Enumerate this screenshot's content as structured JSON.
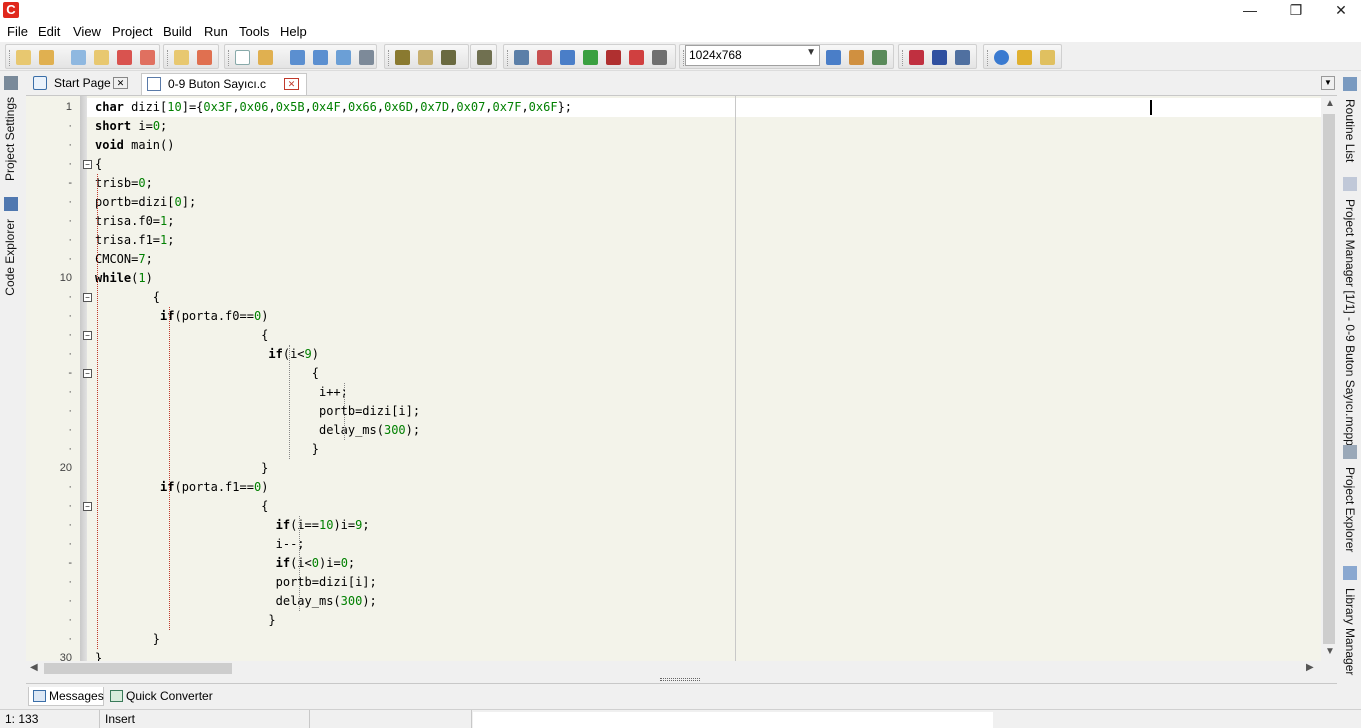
{
  "window": {
    "logo": "C",
    "min": "—",
    "max": "❐",
    "close": "✕"
  },
  "menu": [
    "File",
    "Edit",
    "View",
    "Project",
    "Build",
    "Run",
    "Tools",
    "Help"
  ],
  "toolbar": {
    "resolution": "1024x768"
  },
  "left_dock": {
    "project_settings": "Project Settings",
    "code_explorer": "Code Explorer"
  },
  "right_dock": {
    "routine_list": "Routine List",
    "project_manager": "Project Manager [1/1] - 0-9 Buton Sayıcı.mcppi",
    "project_explorer": "Project Explorer",
    "library_manager": "Library Manager"
  },
  "tabs": {
    "start_page": "Start Page",
    "file": "0-9 Buton Sayıcı.c"
  },
  "code": {
    "lines": [
      {
        "n": "1",
        "text": "char dizi[10]={0x3F,0x06,0x5B,0x4F,0x66,0x6D,0x7D,0x07,0x7F,0x6F};"
      },
      {
        "n": "·",
        "text": "short i=0;"
      },
      {
        "n": "·",
        "text": "void main()"
      },
      {
        "n": "·",
        "text": "{"
      },
      {
        "n": "-",
        "text": "trisb=0;"
      },
      {
        "n": "·",
        "text": "portb=dizi[0];"
      },
      {
        "n": "·",
        "text": "trisa.f0=1;"
      },
      {
        "n": "·",
        "text": "trisa.f1=1;"
      },
      {
        "n": "·",
        "text": "CMCON=7;"
      },
      {
        "n": "10",
        "text": "while(1)"
      },
      {
        "n": "·",
        "text": "        {"
      },
      {
        "n": "·",
        "text": "         if(porta.f0==0)"
      },
      {
        "n": "·",
        "text": "                       {"
      },
      {
        "n": "·",
        "text": "                        if(i<9)"
      },
      {
        "n": "-",
        "text": "                              {"
      },
      {
        "n": "·",
        "text": "                               i++;"
      },
      {
        "n": "·",
        "text": "                               portb=dizi[i];"
      },
      {
        "n": "·",
        "text": "                               delay_ms(300);"
      },
      {
        "n": "·",
        "text": "                              }"
      },
      {
        "n": "20",
        "text": "                       }"
      },
      {
        "n": "·",
        "text": "         if(porta.f1==0)"
      },
      {
        "n": "·",
        "text": "                       {"
      },
      {
        "n": "·",
        "text": "                         if(i==10)i=9;"
      },
      {
        "n": "·",
        "text": "                         i--;"
      },
      {
        "n": "-",
        "text": "                         if(i<0)i=0;"
      },
      {
        "n": "·",
        "text": "                         portb=dizi[i];"
      },
      {
        "n": "·",
        "text": "                         delay_ms(300);"
      },
      {
        "n": "·",
        "text": "                        }"
      },
      {
        "n": "·",
        "text": "        }"
      },
      {
        "n": "30",
        "text": "}"
      }
    ]
  },
  "bottom_tabs": {
    "messages": "Messages",
    "quick_converter": "Quick Converter"
  },
  "status": {
    "position": "1: 133",
    "mode": "Insert"
  }
}
